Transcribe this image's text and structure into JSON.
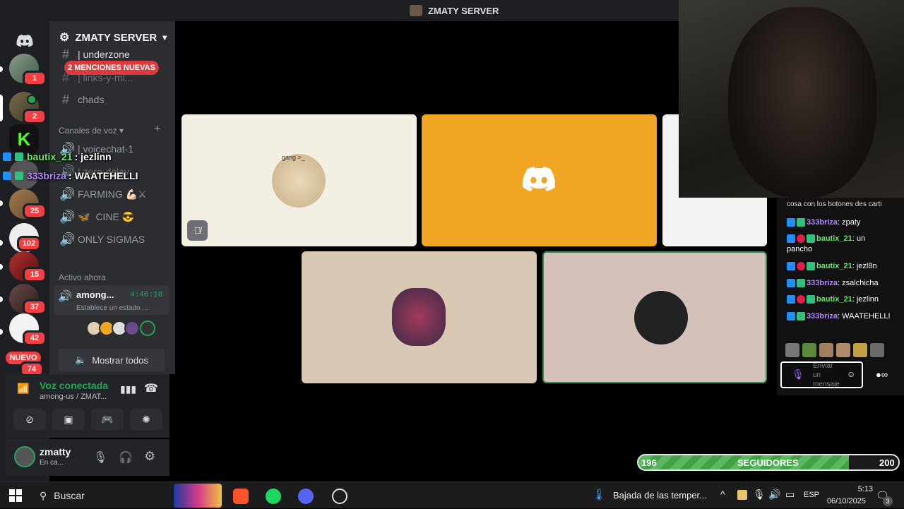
{
  "window": {
    "title": "ZMATY SERVER"
  },
  "guilds": {
    "items": [
      {
        "badge": "1"
      },
      {
        "badge": "2"
      },
      {
        "badge": ""
      },
      {
        "badge": ""
      },
      {
        "badge": "25"
      },
      {
        "badge": "102"
      },
      {
        "badge": "15"
      },
      {
        "badge": "37"
      },
      {
        "badge": "42"
      },
      {
        "badge": "74"
      }
    ],
    "new_label": "NUEVO"
  },
  "server": {
    "name": "ZMATY SERVER"
  },
  "channels": {
    "text_partial": "| underzone",
    "mentions_pill": "2 MENCIONES NUEVAS",
    "links_partial": "| links-y-mi...",
    "chads": "chads",
    "voice_category": "Canales de voz",
    "voice": [
      "| voicechat-1",
      "| zero-delay ...",
      "FARMING 💪🏻⚔",
      "CINE 😎",
      "ONLY SIGMAS"
    ],
    "cine_prefix": "🦋",
    "active_now": "Activo ahora",
    "active_name": "among...",
    "active_timer": "4:46:18",
    "active_status": "Establece un estado ...",
    "show_all": "Mostrar todos"
  },
  "voice": {
    "status": "Voz conectada",
    "channel": "among-us / ZMAT..."
  },
  "user": {
    "name": "zmatty",
    "status": "En ca..."
  },
  "stream_overlay": {
    "line1_user": "bautix_21",
    "line1_text": " : jezlinn",
    "line2_user": "333briza",
    "line2_text": " : WAATEHELLI"
  },
  "tiles": {
    "tile1_caption": "gang >_"
  },
  "chat": {
    "top_partial": "cosa con los botones des carti",
    "messages": [
      {
        "user": "333briza",
        "user_color": "#b388ff",
        "text": ": zpaty"
      },
      {
        "user": "bautix_21",
        "user_color": "#6ee36e",
        "text": ": un pancho"
      },
      {
        "user": "bautix_21",
        "user_color": "#6ee36e",
        "text": ": jezl8n"
      },
      {
        "user": "333briza",
        "user_color": "#b388ff",
        "text": ": zsalchicha"
      },
      {
        "user": "bautix_21",
        "user_color": "#6ee36e",
        "text": ": jezlinn"
      },
      {
        "user": "333briza",
        "user_color": "#b388ff",
        "text": ": WAATEHELLI"
      }
    ],
    "input_placeholder": "Enviar un mensaje"
  },
  "followers": {
    "current": "196",
    "label": "SEGUIDORES",
    "goal": "200",
    "progress": 0.98
  },
  "taskbar": {
    "search": "Buscar",
    "weather": "Bajada de las temper...",
    "lang": "ESP",
    "time": "5:13",
    "date": "06/10/2025",
    "notif": "3"
  },
  "colors": {
    "discord_bg": "#1e1f22",
    "channel_bg": "#2b2d31",
    "orange_tile": "#f0a623",
    "speaking_border": "#2e8b57",
    "follower_green": "#4caf50"
  }
}
